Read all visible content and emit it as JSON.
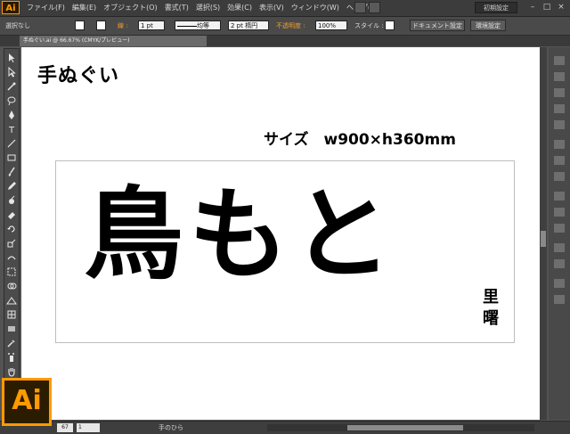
{
  "app": {
    "logo": "Ai",
    "big_logo": "Ai"
  },
  "menu": {
    "items": [
      "ファイル(F)",
      "編集(E)",
      "オブジェクト(O)",
      "書式(T)",
      "選択(S)",
      "効果(C)",
      "表示(V)",
      "ウィンドウ(W)",
      "ヘルプ(H)"
    ],
    "workspace": "初期設定",
    "window_controls": [
      "–",
      "□",
      "×"
    ]
  },
  "control_bar": {
    "selection_status": "選択なし",
    "stroke_label": "線 :",
    "stroke_weight": "1 pt",
    "stroke_profile": "均等",
    "brush": "2 pt 楕円",
    "opacity_label": "不透明度 :",
    "opacity_value": "100%",
    "style_label": "スタイル :",
    "doc_setup_button": "ドキュメント設定",
    "prefs_button": "環境設定"
  },
  "document": {
    "tab_label": "手ぬぐい.ai @ 66.67% (CMYK/プレビュー)"
  },
  "artwork": {
    "title": "手ぬぐい",
    "size_text": "サイズ　w900×h360mm",
    "main_text": "鳥もと",
    "signature": "里曙"
  },
  "status_bar": {
    "zoom": "67",
    "page": "1",
    "tool_name": "手のひら"
  },
  "colors": {
    "accent": "#ff9a00",
    "chrome_dark": "#3c3c3c",
    "chrome_mid": "#535353",
    "canvas": "#ffffff"
  }
}
